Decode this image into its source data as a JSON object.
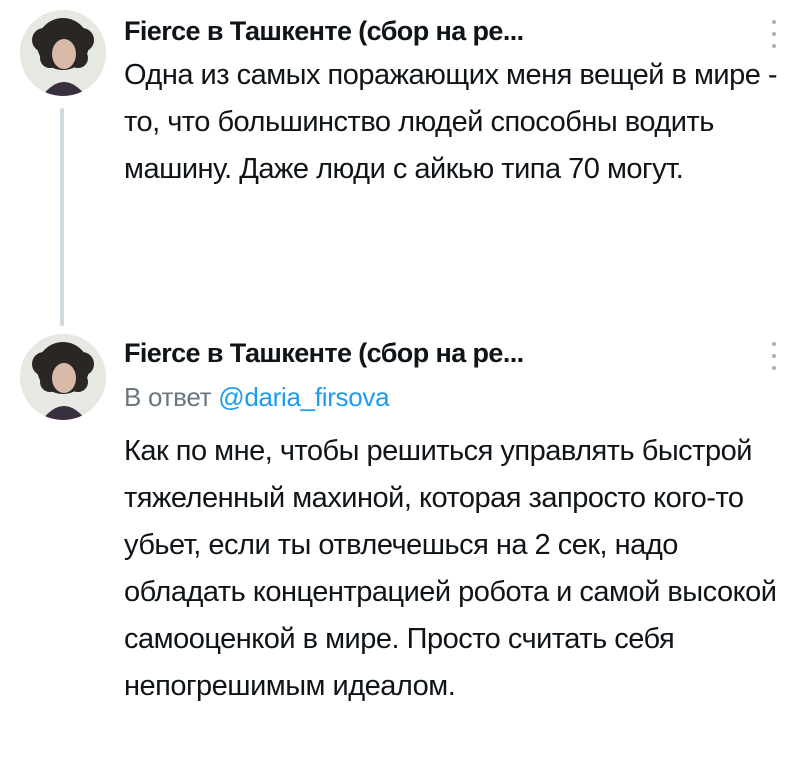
{
  "tweets": [
    {
      "author": "Fierce в Ташкенте (сбор на ре...",
      "text": "Одна из самых поражающих меня вещей в мире - то, что большинство людей способны водить машину. Даже люди с айкью типа 70 могут."
    },
    {
      "author": "Fierce в Ташкенте (сбор на ре...",
      "reply_prefix": "В ответ",
      "reply_handle": "@daria_firsova",
      "text": "Как по мне, чтобы решиться управлять быстрой тяжеленный махиной, которая запросто кого-то убьет, если ты отвлечешься на 2 сек, надо обладать концентрацией робота и самой высокой самооценкой в мире. Просто считать себя непогрешимым идеалом."
    }
  ],
  "icons": {
    "more": "more-vertical-icon"
  },
  "colors": {
    "link": "#1d9bf0",
    "secondary_text": "#6a7782",
    "thread_line": "#cfd9de"
  }
}
